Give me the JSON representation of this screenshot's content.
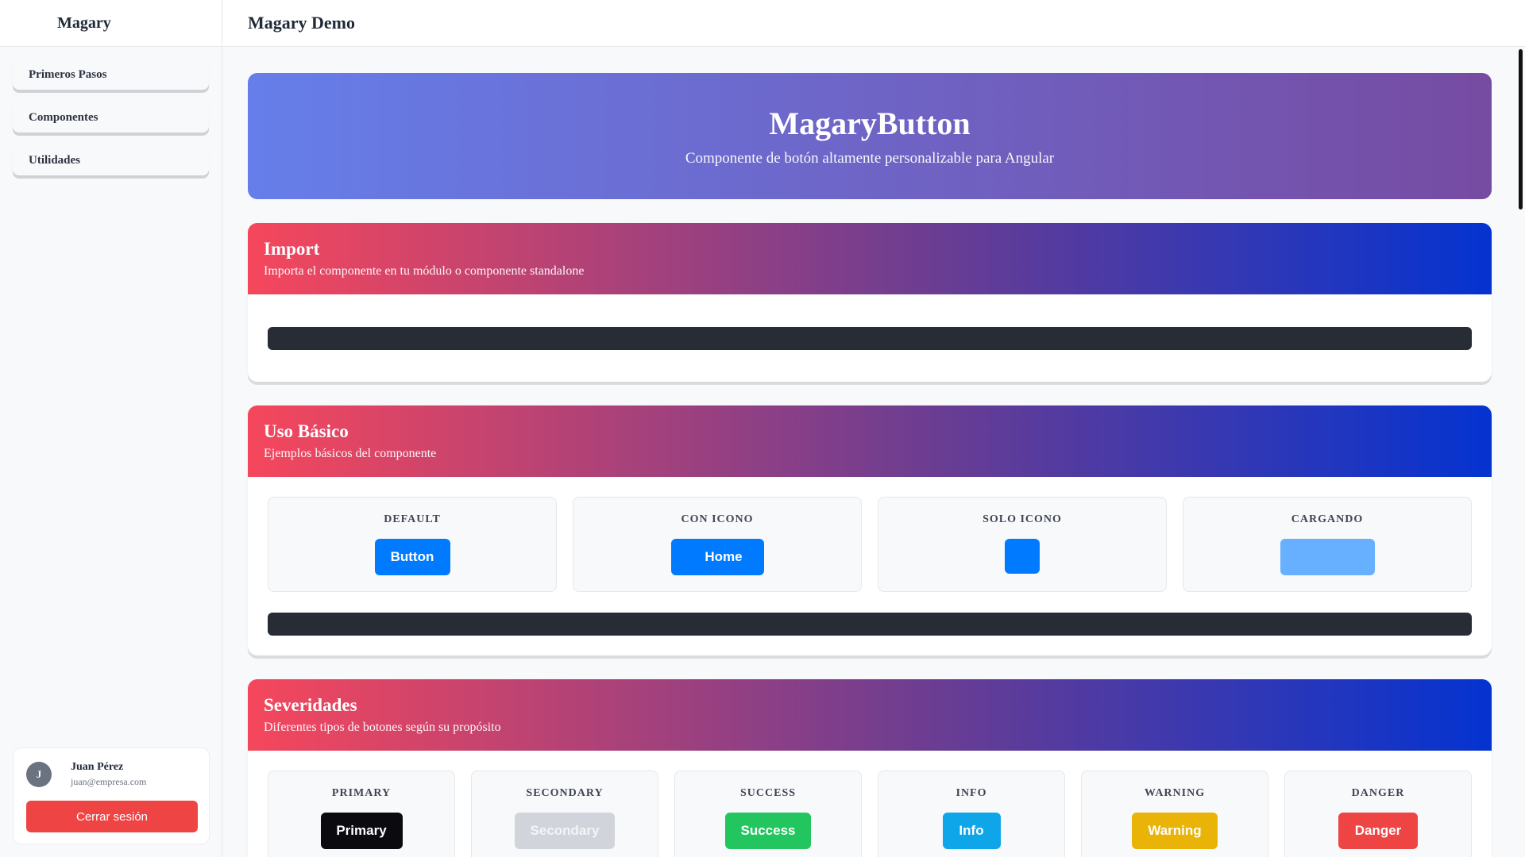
{
  "sidebar": {
    "brand": "Magary",
    "items": [
      {
        "label": "Primeros Pasos"
      },
      {
        "label": "Componentes"
      },
      {
        "label": "Utilidades"
      }
    ],
    "user": {
      "initial": "J",
      "name": "Juan Pérez",
      "email": "juan@empresa.com",
      "logout_label": "Cerrar sesión"
    }
  },
  "header": {
    "title": "Magary Demo"
  },
  "hero": {
    "title": "MagaryButton",
    "subtitle": "Componente de botón altamente personalizable para Angular"
  },
  "sections": {
    "import": {
      "title": "Import",
      "description": "Importa el componente en tu módulo o componente standalone"
    },
    "basic": {
      "title": "Uso Básico",
      "description": "Ejemplos básicos del componente",
      "demos": [
        {
          "label": "DEFAULT",
          "button": "Button"
        },
        {
          "label": "CON ICONO",
          "button": "Home"
        },
        {
          "label": "SOLO ICONO",
          "button": ""
        },
        {
          "label": "CARGANDO",
          "button": ""
        }
      ]
    },
    "severities": {
      "title": "Severidades",
      "description": "Diferentes tipos de botones según su propósito",
      "items": [
        {
          "label": "PRIMARY",
          "button": "Primary",
          "color": "#0b0b0f"
        },
        {
          "label": "SECONDARY",
          "button": "Secondary",
          "color": "#d1d5db"
        },
        {
          "label": "SUCCESS",
          "button": "Success",
          "color": "#22c55e"
        },
        {
          "label": "INFO",
          "button": "Info",
          "color": "#0ea5e9"
        },
        {
          "label": "WARNING",
          "button": "Warning",
          "color": "#eab308"
        },
        {
          "label": "DANGER",
          "button": "Danger",
          "color": "#ef4444"
        }
      ]
    }
  },
  "colors": {
    "button_blue": "#007bff",
    "loading_blue": "#66b0ff"
  }
}
